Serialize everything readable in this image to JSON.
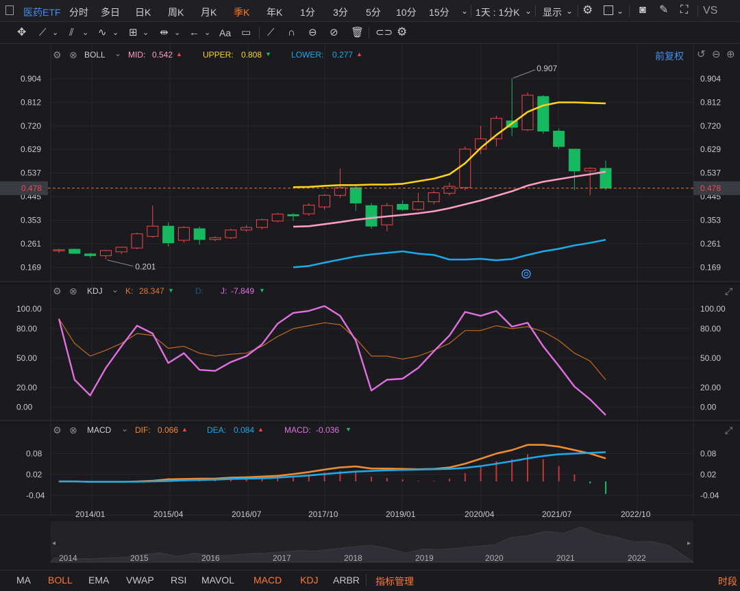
{
  "topbar": {
    "symbol": "医药ETF",
    "periods": [
      "分时",
      "多日",
      "日K",
      "周K",
      "月K",
      "季K",
      "年K",
      "1分",
      "3分",
      "5分",
      "10分",
      "15分"
    ],
    "active_period": "季K",
    "interval_select": "1天 : 1分K",
    "display_label": "显示",
    "vs_label": "VS"
  },
  "boll": {
    "name": "BOLL",
    "mid_label": "MID:",
    "mid_value": "0.542",
    "upper_label": "UPPER:",
    "upper_value": "0.808",
    "lower_label": "LOWER:",
    "lower_value": "0.277",
    "adjust": "前复权",
    "max_label": "0.907",
    "min_label": "0.201",
    "current_price": "0.478",
    "y_ticks": [
      "0.904",
      "0.812",
      "0.720",
      "0.629",
      "0.537",
      "0.445",
      "0.353",
      "0.261",
      "0.169"
    ],
    "colors": {
      "mid": "#ff9ec4",
      "upper": "#ffd21a",
      "lower": "#1da8e6",
      "up": "#f04848",
      "down": "#16b860"
    }
  },
  "kdj": {
    "name": "KDJ",
    "k_label": "K:",
    "k_value": "28.347",
    "d_label": "D:",
    "j_label": "J:",
    "j_value": "-7.849",
    "y_ticks": [
      "100.00",
      "80.00",
      "50.00",
      "20.00",
      "0.00"
    ]
  },
  "macd": {
    "name": "MACD",
    "dif_label": "DIF:",
    "dif_value": "0.066",
    "dea_label": "DEA:",
    "dea_value": "0.084",
    "macd_label": "MACD:",
    "macd_value": "-0.036",
    "y_ticks": [
      "0.08",
      "0.02",
      "-0.04"
    ]
  },
  "x_axis": {
    "labels": [
      "2014/01",
      "2015/04",
      "2016/07",
      "2017/10",
      "2019/01",
      "2020/04",
      "2021/07",
      "2022/10"
    ]
  },
  "overview": {
    "years": [
      "2014",
      "2015",
      "2016",
      "2017",
      "2018",
      "2019",
      "2020",
      "2021",
      "2022"
    ]
  },
  "bottombar": {
    "items": [
      "MA",
      "BOLL",
      "EMA",
      "VWAP",
      "RSI",
      "MAVOL",
      "MACD",
      "KDJ",
      "ARBR",
      "指标管理"
    ],
    "right": "时段"
  },
  "chart_data": [
    {
      "type": "candlestick",
      "title": "BOLL",
      "ylim": [
        0.12,
        0.96
      ],
      "candles": [
        {
          "o": 0.238,
          "h": 0.242,
          "l": 0.226,
          "c": 0.238
        },
        {
          "o": 0.24,
          "h": 0.243,
          "l": 0.222,
          "c": 0.224
        },
        {
          "o": 0.222,
          "h": 0.226,
          "l": 0.206,
          "c": 0.215
        },
        {
          "o": 0.215,
          "h": 0.238,
          "l": 0.201,
          "c": 0.235
        },
        {
          "o": 0.23,
          "h": 0.25,
          "l": 0.222,
          "c": 0.248
        },
        {
          "o": 0.245,
          "h": 0.305,
          "l": 0.24,
          "c": 0.3
        },
        {
          "o": 0.29,
          "h": 0.41,
          "l": 0.285,
          "c": 0.33
        },
        {
          "o": 0.33,
          "h": 0.345,
          "l": 0.25,
          "c": 0.265
        },
        {
          "o": 0.275,
          "h": 0.33,
          "l": 0.265,
          "c": 0.325
        },
        {
          "o": 0.32,
          "h": 0.328,
          "l": 0.258,
          "c": 0.278
        },
        {
          "o": 0.278,
          "h": 0.29,
          "l": 0.272,
          "c": 0.285
        },
        {
          "o": 0.285,
          "h": 0.32,
          "l": 0.28,
          "c": 0.315
        },
        {
          "o": 0.315,
          "h": 0.335,
          "l": 0.308,
          "c": 0.325
        },
        {
          "o": 0.325,
          "h": 0.36,
          "l": 0.318,
          "c": 0.355
        },
        {
          "o": 0.35,
          "h": 0.382,
          "l": 0.345,
          "c": 0.377
        },
        {
          "o": 0.375,
          "h": 0.38,
          "l": 0.35,
          "c": 0.37
        },
        {
          "o": 0.378,
          "h": 0.42,
          "l": 0.37,
          "c": 0.412
        },
        {
          "o": 0.405,
          "h": 0.455,
          "l": 0.395,
          "c": 0.45
        },
        {
          "o": 0.45,
          "h": 0.555,
          "l": 0.44,
          "c": 0.48
        },
        {
          "o": 0.48,
          "h": 0.49,
          "l": 0.39,
          "c": 0.42
        },
        {
          "o": 0.41,
          "h": 0.42,
          "l": 0.32,
          "c": 0.33
        },
        {
          "o": 0.335,
          "h": 0.42,
          "l": 0.31,
          "c": 0.41
        },
        {
          "o": 0.415,
          "h": 0.43,
          "l": 0.39,
          "c": 0.395
        },
        {
          "o": 0.395,
          "h": 0.46,
          "l": 0.39,
          "c": 0.425
        },
        {
          "o": 0.425,
          "h": 0.47,
          "l": 0.415,
          "c": 0.46
        },
        {
          "o": 0.458,
          "h": 0.5,
          "l": 0.45,
          "c": 0.485
        },
        {
          "o": 0.48,
          "h": 0.64,
          "l": 0.47,
          "c": 0.63
        },
        {
          "o": 0.63,
          "h": 0.72,
          "l": 0.61,
          "c": 0.67
        },
        {
          "o": 0.67,
          "h": 0.76,
          "l": 0.64,
          "c": 0.75
        },
        {
          "o": 0.74,
          "h": 0.907,
          "l": 0.68,
          "c": 0.715
        },
        {
          "o": 0.705,
          "h": 0.85,
          "l": 0.7,
          "c": 0.84
        },
        {
          "o": 0.835,
          "h": 0.84,
          "l": 0.69,
          "c": 0.7
        },
        {
          "o": 0.7,
          "h": 0.71,
          "l": 0.63,
          "c": 0.64
        },
        {
          "o": 0.63,
          "h": 0.63,
          "l": 0.47,
          "c": 0.545
        },
        {
          "o": 0.545,
          "h": 0.56,
          "l": 0.45,
          "c": 0.555
        },
        {
          "o": 0.555,
          "h": 0.585,
          "l": 0.47,
          "c": 0.478
        }
      ],
      "boll_upper": [
        0.482,
        0.483,
        0.487,
        0.49,
        0.49,
        0.492,
        0.492,
        0.495,
        0.505,
        0.515,
        0.532,
        0.575,
        0.635,
        0.685,
        0.73,
        0.775,
        0.8,
        0.812,
        0.812,
        0.81,
        0.808
      ],
      "boll_mid": [
        0.328,
        0.33,
        0.338,
        0.346,
        0.355,
        0.362,
        0.368,
        0.374,
        0.38,
        0.388,
        0.4,
        0.415,
        0.43,
        0.448,
        0.466,
        0.488,
        0.503,
        0.513,
        0.523,
        0.532,
        0.542
      ],
      "boll_lower": [
        0.17,
        0.175,
        0.188,
        0.2,
        0.212,
        0.22,
        0.226,
        0.232,
        0.223,
        0.218,
        0.2,
        0.2,
        0.203,
        0.197,
        0.202,
        0.218,
        0.232,
        0.242,
        0.255,
        0.265,
        0.277
      ]
    },
    {
      "type": "line",
      "title": "KDJ",
      "ylim": [
        -10,
        105
      ],
      "series": [
        {
          "name": "K",
          "values": [
            90,
            65,
            52,
            58,
            65,
            75,
            73,
            60,
            62,
            55,
            52,
            54,
            55,
            62,
            72,
            80,
            83,
            86,
            84,
            70,
            52,
            52,
            49,
            52,
            58,
            65,
            78,
            78,
            83,
            80,
            82,
            77,
            68,
            55,
            47,
            28
          ]
        },
        {
          "name": "J",
          "values": [
            90,
            28,
            12,
            40,
            62,
            83,
            75,
            45,
            55,
            38,
            37,
            46,
            52,
            64,
            85,
            96,
            98,
            103,
            93,
            68,
            17,
            28,
            29,
            40,
            57,
            73,
            97,
            93,
            98,
            82,
            86,
            62,
            42,
            21,
            8,
            -8
          ]
        }
      ]
    },
    {
      "type": "bar",
      "title": "MACD",
      "ylim": [
        -0.065,
        0.12
      ],
      "series": [
        {
          "name": "DIF",
          "values": [
            0.0,
            0.0,
            -0.001,
            -0.001,
            -0.001,
            0.0,
            0.002,
            0.006,
            0.007,
            0.008,
            0.008,
            0.011,
            0.012,
            0.014,
            0.016,
            0.021,
            0.027,
            0.034,
            0.04,
            0.043,
            0.037,
            0.037,
            0.036,
            0.035,
            0.036,
            0.04,
            0.051,
            0.065,
            0.08,
            0.09,
            0.105,
            0.105,
            0.1,
            0.09,
            0.08,
            0.066
          ]
        },
        {
          "name": "DEA",
          "values": [
            0.0,
            0.0,
            -0.001,
            -0.001,
            -0.001,
            -0.001,
            0.0,
            0.001,
            0.003,
            0.004,
            0.005,
            0.007,
            0.008,
            0.009,
            0.011,
            0.014,
            0.017,
            0.021,
            0.025,
            0.028,
            0.03,
            0.032,
            0.033,
            0.034,
            0.035,
            0.036,
            0.039,
            0.044,
            0.051,
            0.058,
            0.066,
            0.073,
            0.078,
            0.08,
            0.082,
            0.084
          ]
        },
        {
          "name": "MACD",
          "values": [
            0.0,
            0.0,
            0.0,
            0.0,
            0.0,
            0.001,
            0.004,
            0.01,
            0.008,
            0.008,
            0.006,
            0.008,
            0.008,
            0.01,
            0.01,
            0.014,
            0.02,
            0.026,
            0.03,
            0.03,
            0.014,
            0.01,
            0.006,
            0.002,
            0.002,
            0.008,
            0.024,
            0.042,
            0.058,
            0.064,
            0.078,
            0.064,
            0.044,
            0.02,
            -0.006,
            -0.036
          ]
        }
      ]
    }
  ]
}
